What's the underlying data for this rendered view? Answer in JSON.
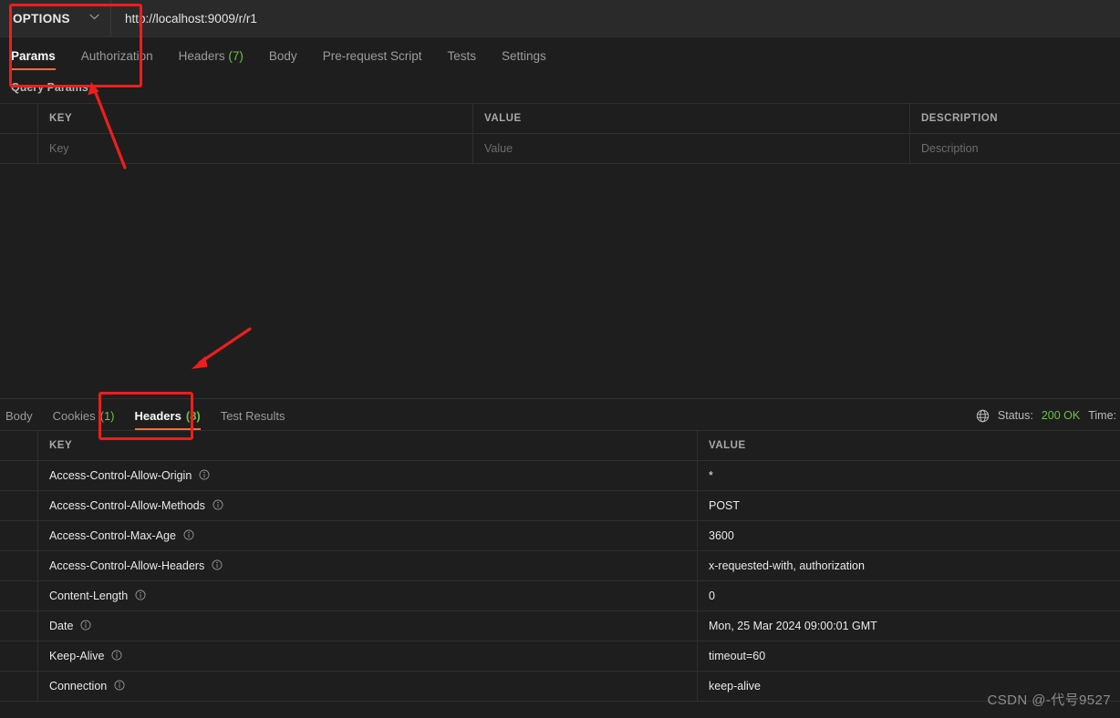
{
  "request": {
    "method": "OPTIONS",
    "url": "http://localhost:9009/r/r1",
    "chevron_icon": "chevron-down-icon",
    "tabs": [
      {
        "label": "Params",
        "count": "",
        "active": true
      },
      {
        "label": "Authorization",
        "count": "",
        "active": false
      },
      {
        "label": "Headers",
        "count": "(7)",
        "active": false
      },
      {
        "label": "Body",
        "count": "",
        "active": false
      },
      {
        "label": "Pre-request Script",
        "count": "",
        "active": false
      },
      {
        "label": "Tests",
        "count": "",
        "active": false
      },
      {
        "label": "Settings",
        "count": "",
        "active": false
      }
    ],
    "query_params_label": "Query Params",
    "params_table": {
      "columns": [
        "KEY",
        "VALUE",
        "DESCRIPTION"
      ],
      "rows": [
        {
          "key": "Key",
          "value": "Value",
          "description": "Description"
        }
      ]
    }
  },
  "response": {
    "tabs": [
      {
        "label": "Body",
        "count": "",
        "active": false
      },
      {
        "label": "Cookies",
        "count": "(1)",
        "active": false
      },
      {
        "label": "Headers",
        "count": "(8)",
        "active": true
      },
      {
        "label": "Test Results",
        "count": "",
        "active": false
      }
    ],
    "globe_icon": "globe-icon",
    "status_label": "Status:",
    "status_value": "200 OK",
    "time_label": "Time:",
    "headers_table": {
      "columns": [
        "KEY",
        "VALUE"
      ],
      "rows": [
        {
          "key": "Access-Control-Allow-Origin",
          "value": "*"
        },
        {
          "key": "Access-Control-Allow-Methods",
          "value": "POST"
        },
        {
          "key": "Access-Control-Max-Age",
          "value": "3600"
        },
        {
          "key": "Access-Control-Allow-Headers",
          "value": "x-requested-with, authorization"
        },
        {
          "key": "Content-Length",
          "value": "0"
        },
        {
          "key": "Date",
          "value": "Mon, 25 Mar 2024 09:00:01 GMT"
        },
        {
          "key": "Keep-Alive",
          "value": "timeout=60"
        },
        {
          "key": "Connection",
          "value": "keep-alive"
        }
      ],
      "row_info_icon": "info-icon"
    }
  },
  "annotations": {
    "box_color": "#f01d1d",
    "box_request_tab": "highlight-box-params-tab",
    "box_response_tab": "highlight-box-response-headers-tab",
    "arrow_top": "arrow-pointing-to-params-tab",
    "arrow_bottom": "arrow-pointing-to-response-headers-tab"
  },
  "watermark": {
    "text": "CSDN @-代号9527"
  },
  "theme": {
    "accent": "#ff6c37",
    "count_green": "#6cc04a",
    "bg": "#1e1e1e",
    "bar_bg": "#2a2a2a",
    "border": "#2f2f2f"
  }
}
